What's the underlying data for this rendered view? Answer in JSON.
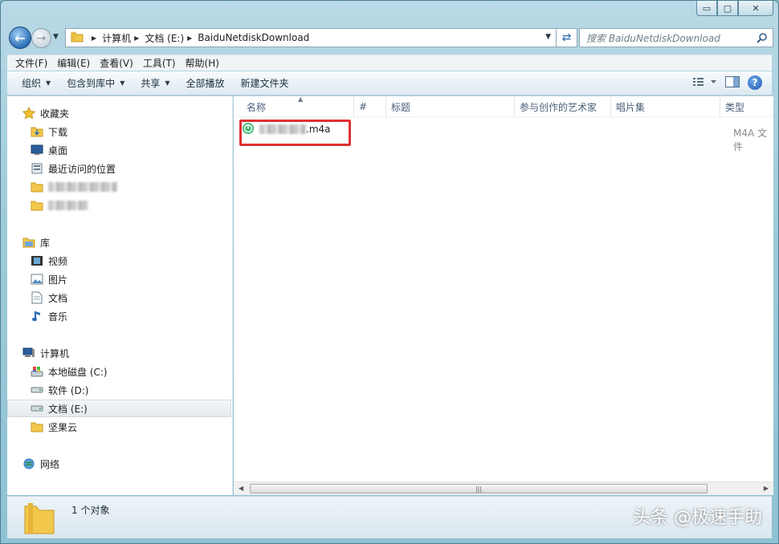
{
  "window": {
    "caption": {
      "minimize": "▭",
      "maximize": "▢",
      "close": "✕"
    }
  },
  "address": {
    "crumbs": [
      "计算机",
      "文档 (E:)",
      "BaiduNetdiskDownload"
    ],
    "search_placeholder": "搜索 BaiduNetdiskDownload"
  },
  "menu": [
    "文件(F)",
    "编辑(E)",
    "查看(V)",
    "工具(T)",
    "帮助(H)"
  ],
  "toolbar": {
    "organize": "组织",
    "include_library": "包含到库中",
    "share": "共享",
    "play_all": "全部播放",
    "new_folder": "新建文件夹"
  },
  "sidebar": {
    "favorites": {
      "label": "收藏夹",
      "items": [
        "下载",
        "桌面",
        "最近访问的位置"
      ]
    },
    "libraries": {
      "label": "库",
      "items": [
        "视频",
        "图片",
        "文档",
        "音乐"
      ]
    },
    "computer": {
      "label": "计算机",
      "items": [
        "本地磁盘 (C:)",
        "软件 (D:)",
        "文档 (E:)",
        "坚果云"
      ]
    },
    "network": {
      "label": "网络"
    }
  },
  "columns": [
    "名称",
    "#",
    "标题",
    "参与创作的艺术家",
    "唱片集",
    "类型"
  ],
  "files": [
    {
      "name_suffix": ".m4a",
      "type": "M4A 文件"
    }
  ],
  "status": {
    "count": "1 个对象"
  },
  "watermark": "头条 @极速手助",
  "colors": {
    "highlight": "#e03131",
    "accent": "#2d6fb7"
  }
}
